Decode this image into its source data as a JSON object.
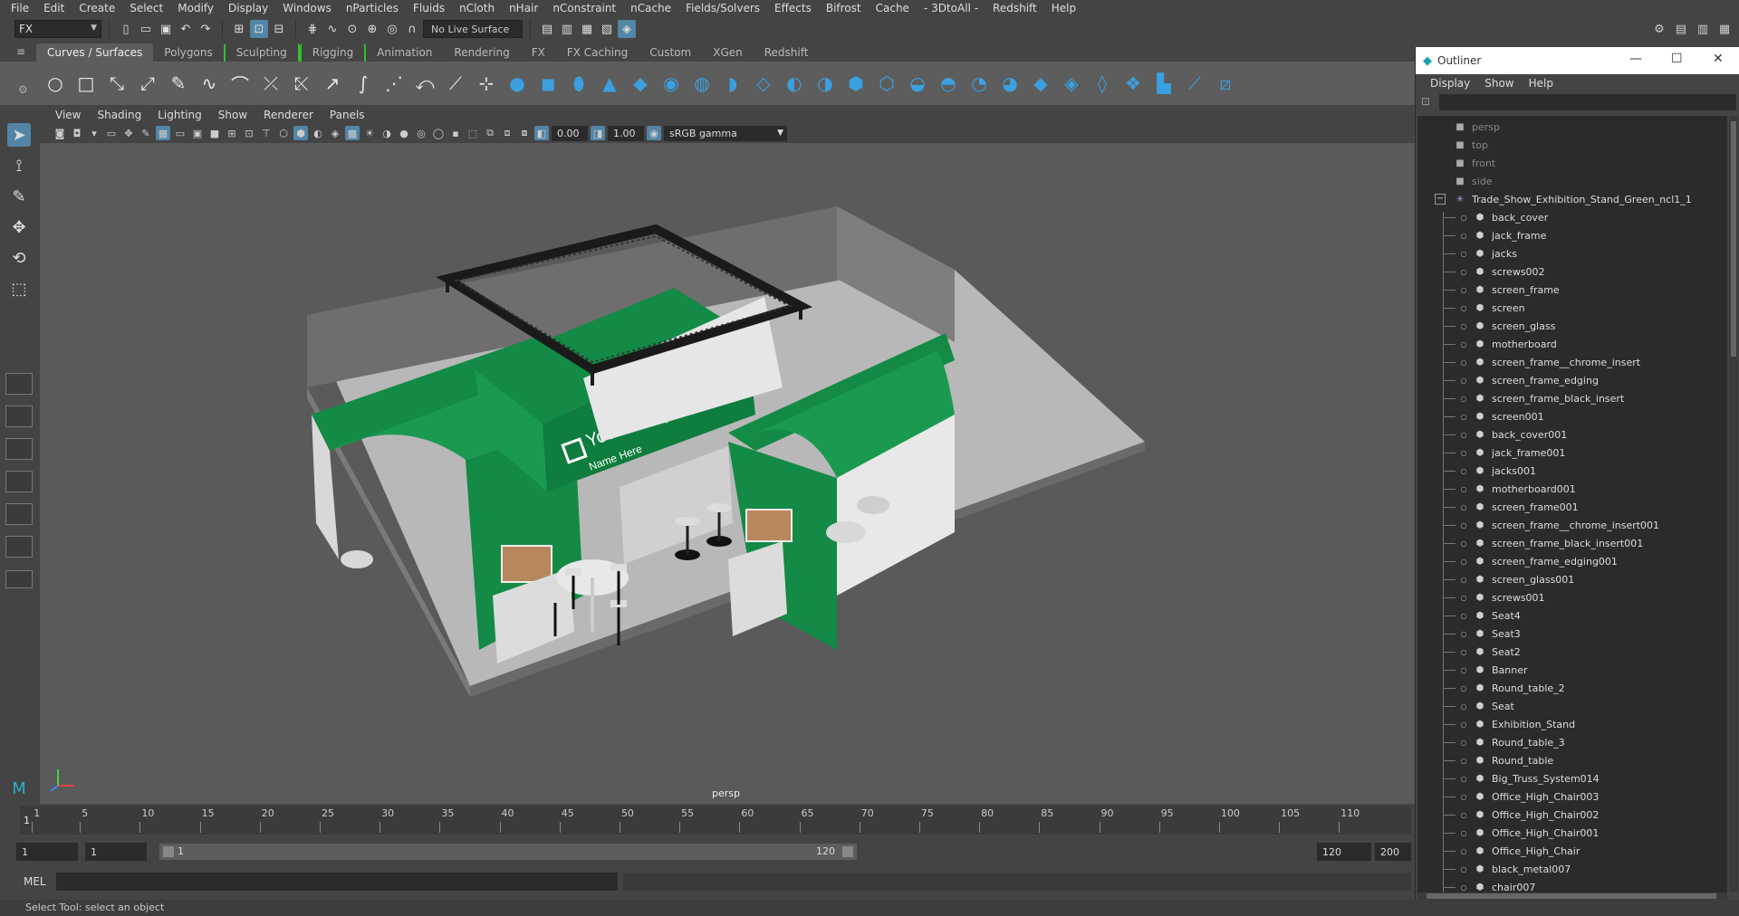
{
  "menubar": [
    "File",
    "Edit",
    "Create",
    "Select",
    "Modify",
    "Display",
    "Windows",
    "nParticles",
    "Fluids",
    "nCloth",
    "nHair",
    "nConstraint",
    "nCache",
    "Fields/Solvers",
    "Effects",
    "Bifrost",
    "Cache",
    "- 3DtoAll -",
    "Redshift",
    "Help"
  ],
  "statusline": {
    "mode": "FX",
    "live_surface": "No Live Surface"
  },
  "shelf_tabs": [
    "Curves / Surfaces",
    "Polygons",
    "Sculpting",
    "Rigging",
    "Animation",
    "Rendering",
    "FX",
    "FX Caching",
    "Custom",
    "XGen",
    "Redshift"
  ],
  "active_shelf": "Curves / Surfaces",
  "viewport": {
    "menu": [
      "View",
      "Shading",
      "Lighting",
      "Show",
      "Renderer",
      "Panels"
    ],
    "exposure": "0.00",
    "gamma_value": "1.00",
    "color_space": "sRGB gamma",
    "camera_label": "persp",
    "scene": {
      "company_name": "Your Company",
      "company_sub": "Name Here",
      "accent": "#138a45"
    }
  },
  "timeslider": {
    "ticks": [
      "1",
      "5",
      "10",
      "15",
      "20",
      "25",
      "30",
      "35",
      "40",
      "45",
      "50",
      "55",
      "60",
      "65",
      "70",
      "75",
      "80",
      "85",
      "90",
      "95",
      "100",
      "105",
      "110"
    ],
    "current_frame": "1"
  },
  "range": {
    "start": "1",
    "playback_start": "1",
    "range_start": "1",
    "range_end": "120",
    "playback_end": "120",
    "end": "200"
  },
  "cmdline": {
    "label": "MEL"
  },
  "helpline": "Select Tool: select an object",
  "outliner": {
    "title": "Outliner",
    "menu": [
      "Display",
      "Show",
      "Help"
    ],
    "cameras": [
      "persp",
      "top",
      "front",
      "side"
    ],
    "root": "Trade_Show_Exhibition_Stand_Green_ncl1_1",
    "items": [
      "back_cover",
      "jack_frame",
      "jacks",
      "screws002",
      "screen_frame",
      "screen",
      "screen_glass",
      "motherboard",
      "screen_frame__chrome_insert",
      "screen_frame_edging",
      "screen_frame_black_insert",
      "screen001",
      "back_cover001",
      "jack_frame001",
      "jacks001",
      "motherboard001",
      "screen_frame001",
      "screen_frame__chrome_insert001",
      "screen_frame_black_insert001",
      "screen_frame_edging001",
      "screen_glass001",
      "screws001",
      "Seat4",
      "Seat3",
      "Seat2",
      "Banner",
      "Round_table_2",
      "Seat",
      "Exhibition_Stand",
      "Round_table_3",
      "Round_table",
      "Big_Truss_System014",
      "Office_High_Chair003",
      "Office_High_Chair002",
      "Office_High_Chair001",
      "Office_High_Chair",
      "black_metal007",
      "chair007"
    ]
  }
}
